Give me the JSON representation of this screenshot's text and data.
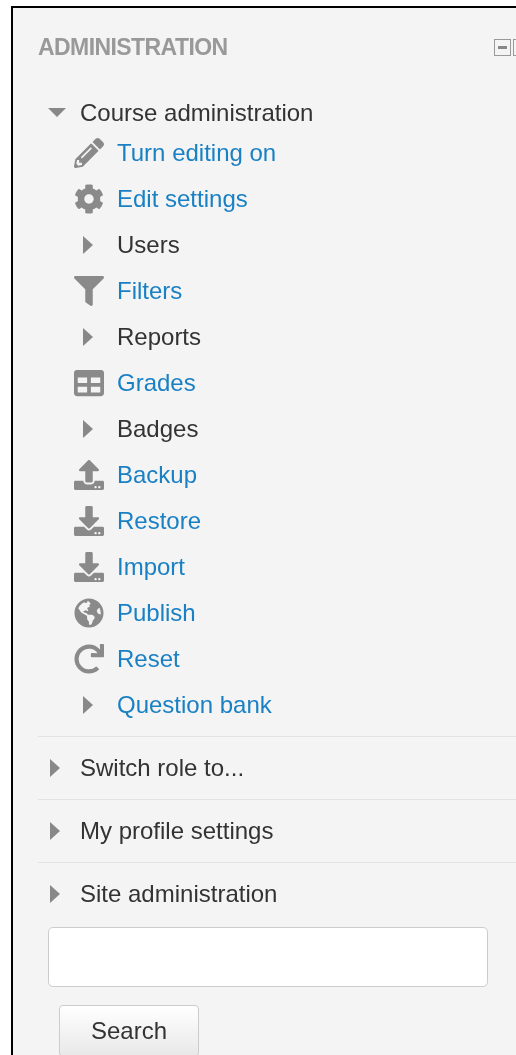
{
  "block": {
    "title": "ADMINISTRATION"
  },
  "sections": [
    {
      "label": "Course administration",
      "expanded": true,
      "children": [
        {
          "label": "Turn editing on",
          "kind": "action",
          "link": true
        },
        {
          "label": "Edit settings",
          "kind": "action",
          "link": true
        },
        {
          "label": "Users",
          "kind": "branch",
          "expanded": false,
          "link": false
        },
        {
          "label": "Filters",
          "kind": "action",
          "link": true
        },
        {
          "label": "Reports",
          "kind": "branch",
          "expanded": false,
          "link": false
        },
        {
          "label": "Grades",
          "kind": "action",
          "link": true
        },
        {
          "label": "Badges",
          "kind": "branch",
          "expanded": false,
          "link": false
        },
        {
          "label": "Backup",
          "kind": "action",
          "link": true
        },
        {
          "label": "Restore",
          "kind": "action",
          "link": true
        },
        {
          "label": "Import",
          "kind": "action",
          "link": true
        },
        {
          "label": "Publish",
          "kind": "action",
          "link": true
        },
        {
          "label": "Reset",
          "kind": "action",
          "link": true
        },
        {
          "label": "Question bank",
          "kind": "branch",
          "expanded": false,
          "link": true
        }
      ]
    },
    {
      "label": "Switch role to...",
      "expanded": false
    },
    {
      "label": "My profile settings",
      "expanded": false
    },
    {
      "label": "Site administration",
      "expanded": false
    }
  ],
  "search": {
    "button": "Search"
  }
}
